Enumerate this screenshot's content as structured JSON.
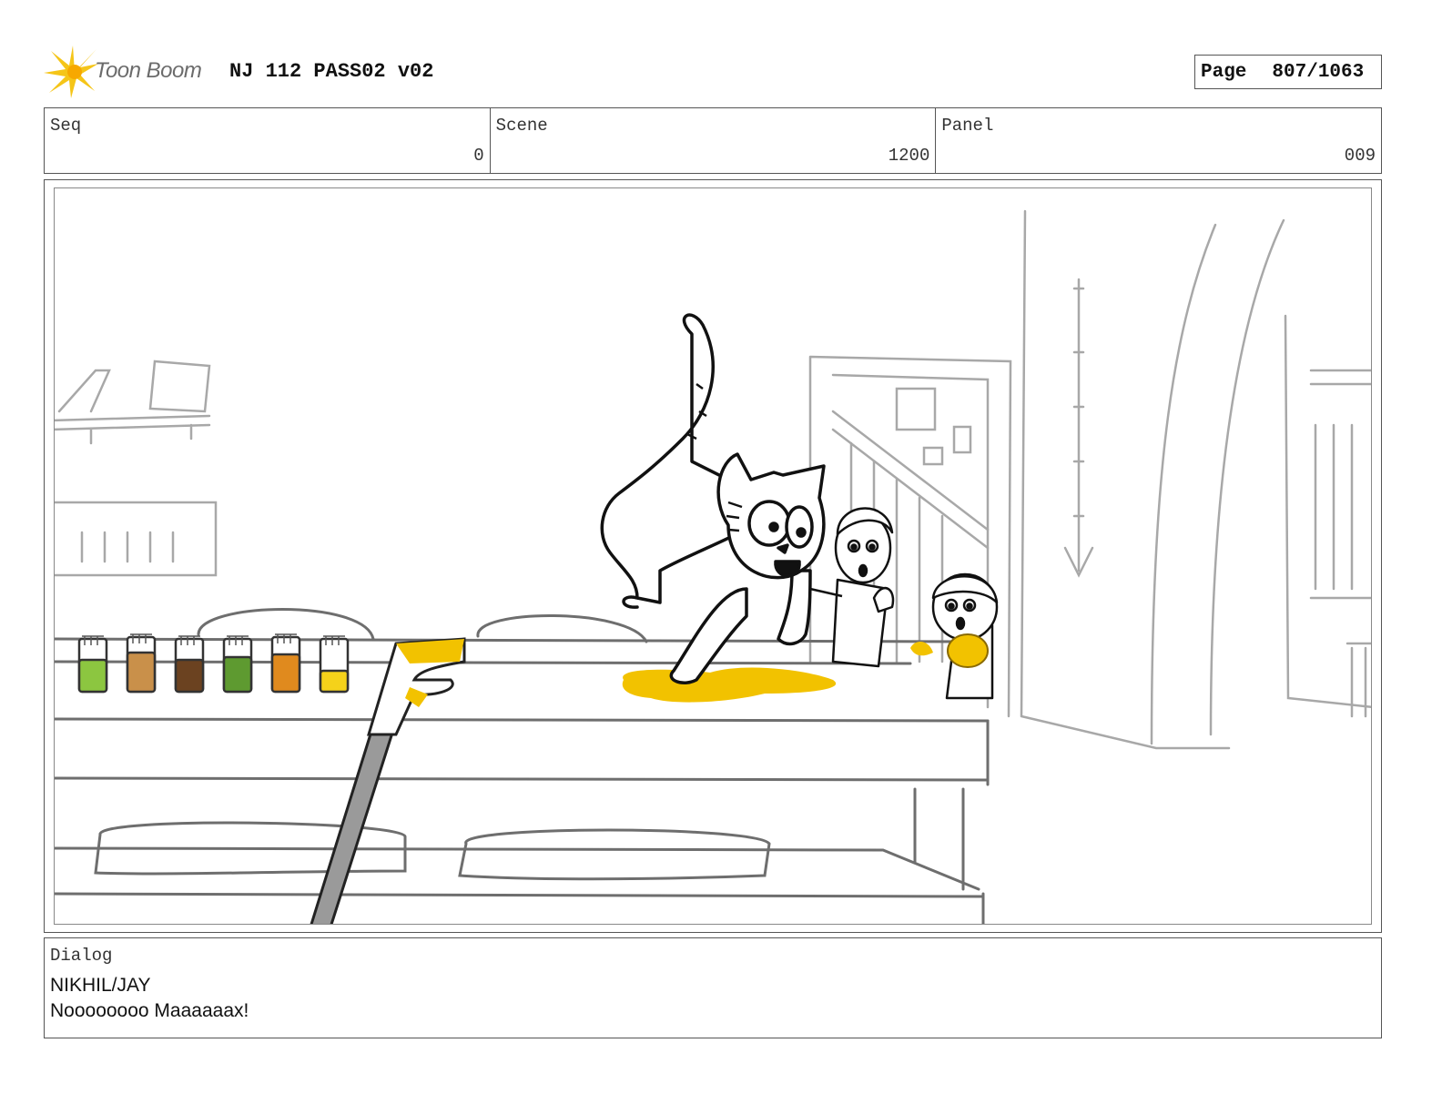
{
  "header": {
    "logo_text": "Toon Boom",
    "project_title": "NJ 112 PASS02 v02",
    "page_label": "Page",
    "page_number": "807/1063"
  },
  "info": {
    "seq_label": "Seq",
    "seq_value": "0",
    "scene_label": "Scene",
    "scene_value": "1200",
    "panel_label": "Panel",
    "panel_value": "009"
  },
  "dialog": {
    "label": "Dialog",
    "speaker": "NIKHIL/JAY",
    "line": "Noooooooo Maaaaaax!"
  },
  "colors": {
    "logo_yellow": "#f5c518",
    "spill_yellow": "#f2c200",
    "jar_colors": [
      "#8cc640",
      "#c9904a",
      "#6b4220",
      "#5e9a30",
      "#e08a1e",
      "#f5d21a"
    ],
    "sketch_gray": "#9a9a9a"
  }
}
